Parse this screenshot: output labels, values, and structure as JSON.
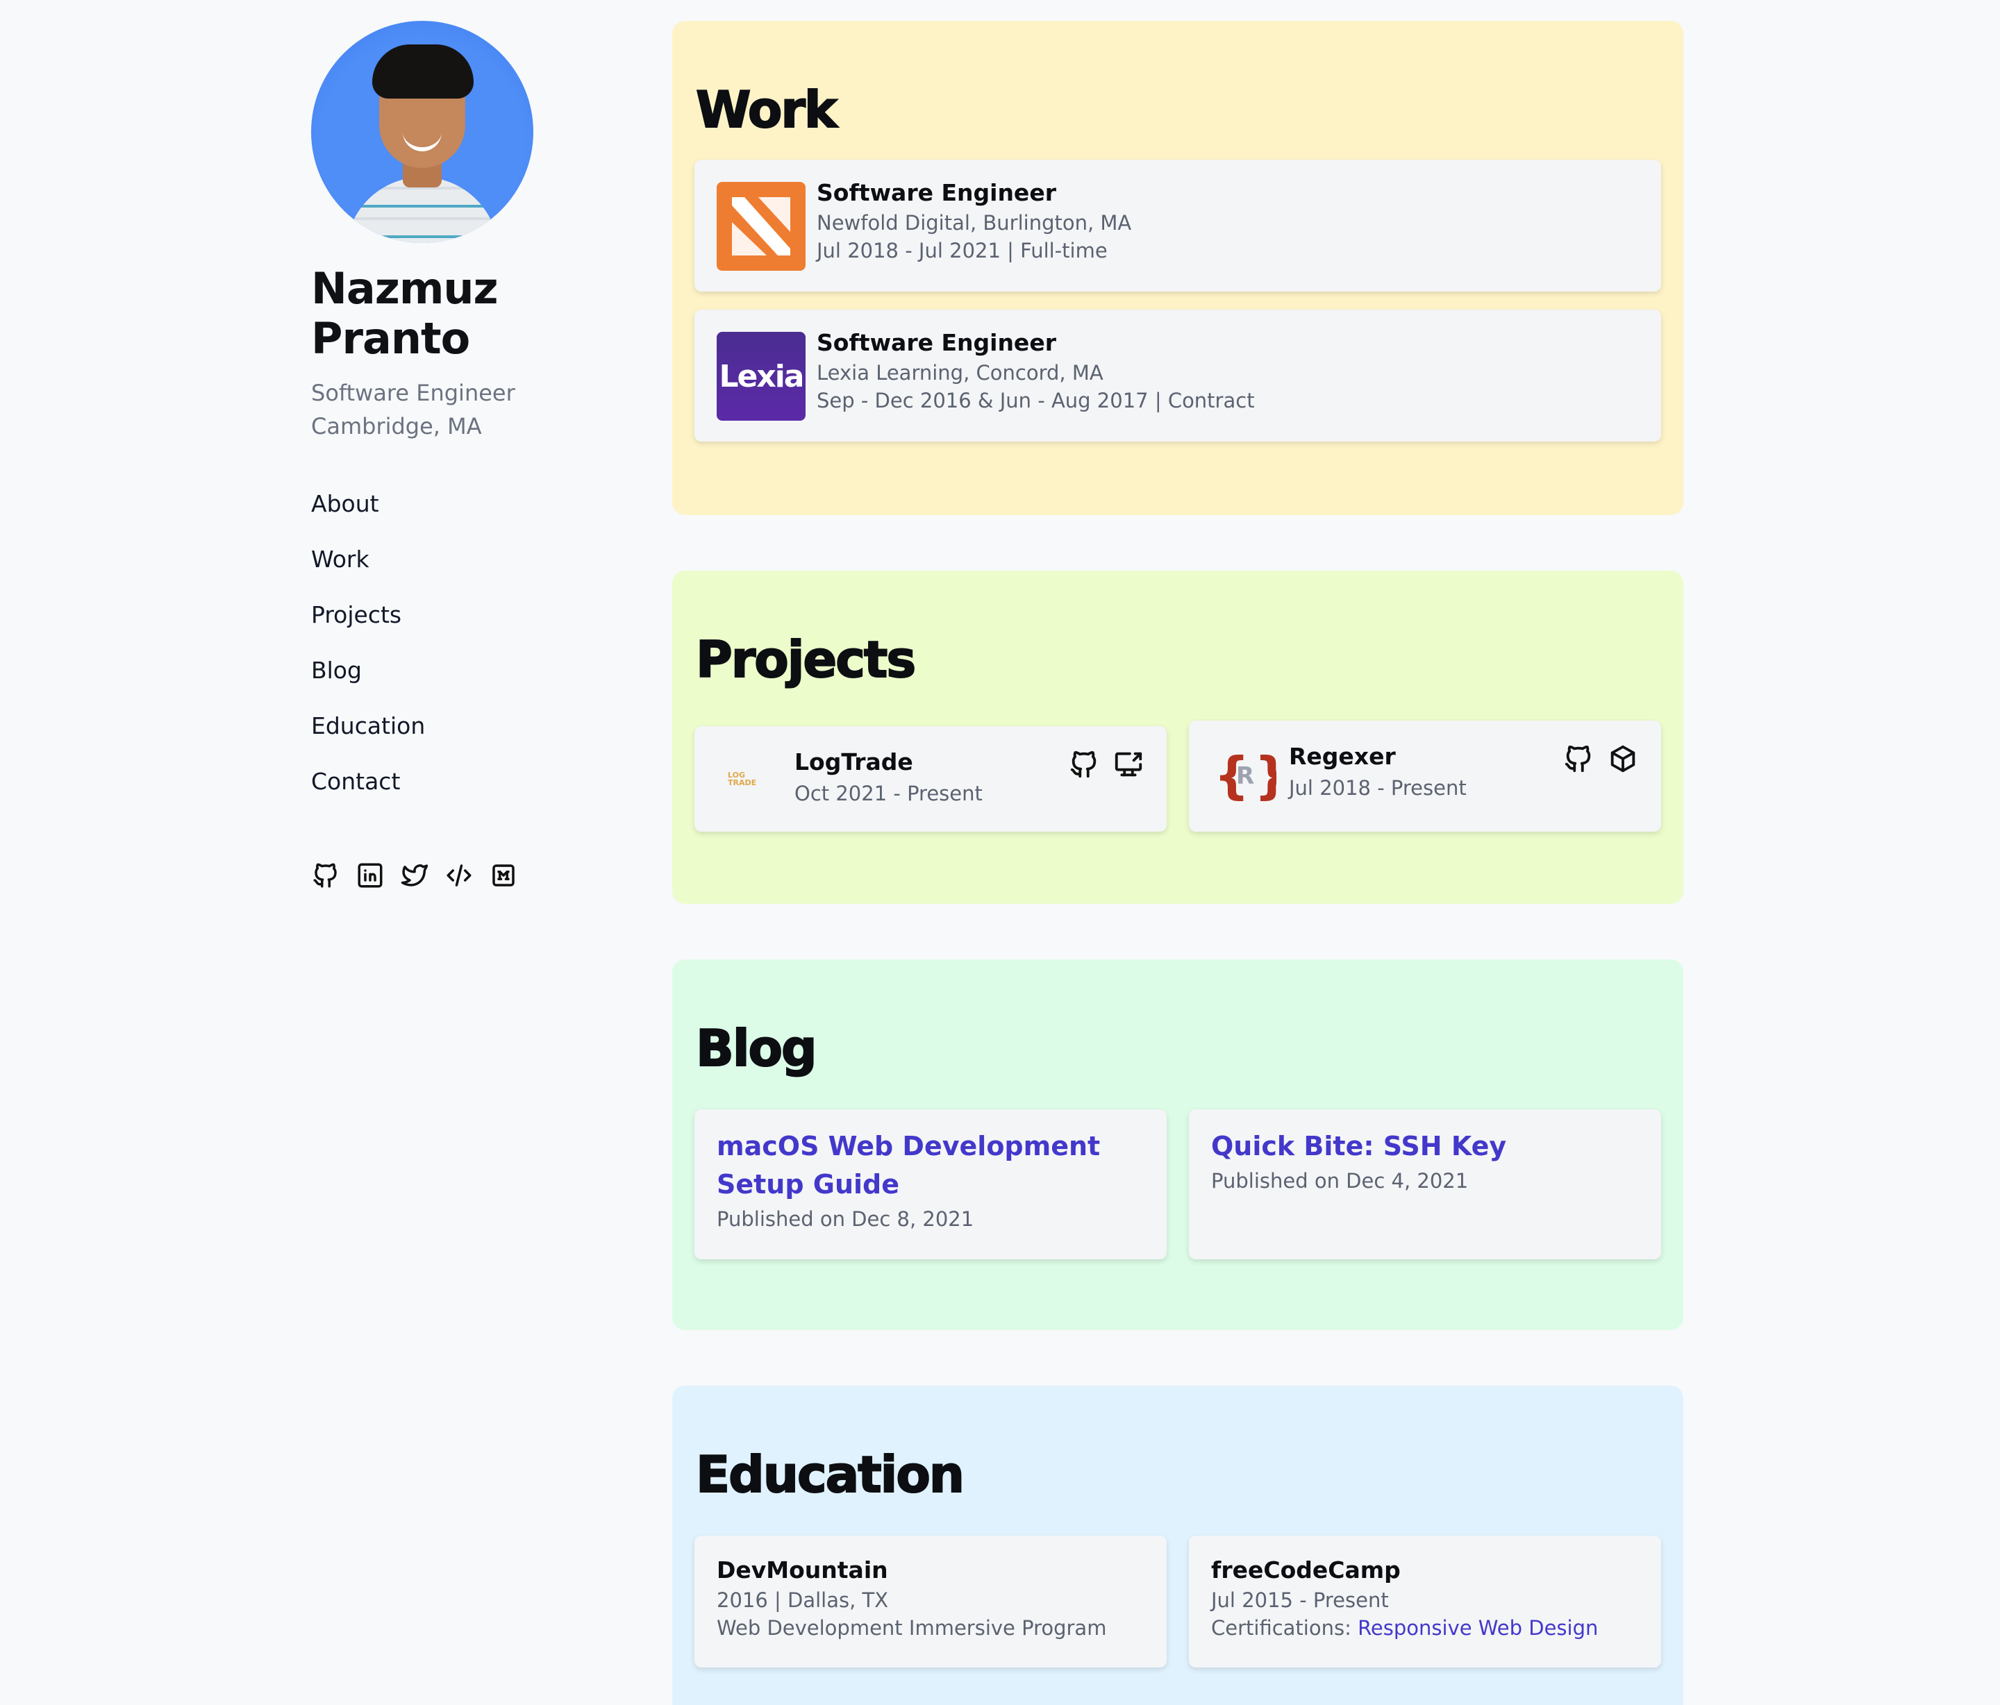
{
  "profile": {
    "name_line1": "Nazmuz",
    "name_line2": "Pranto",
    "role": "Software Engineer",
    "location": "Cambridge, MA"
  },
  "nav": [
    "About",
    "Work",
    "Projects",
    "Blog",
    "Education",
    "Contact"
  ],
  "socials": [
    "github-icon",
    "linkedin-icon",
    "twitter-icon",
    "code-icon",
    "medium-icon"
  ],
  "colors": {
    "work_bg": "#fef3c7",
    "projects_bg": "#ecfccb",
    "blog_bg": "#dcfce7",
    "education_bg": "#e0f2fe",
    "link": "#4338ca"
  },
  "work": {
    "heading": "Work",
    "items": [
      {
        "title": "Software Engineer",
        "company": "Newfold Digital, Burlington, MA",
        "dates": "Jul 2018 - Jul 2021 | Full-time",
        "logo": "newfold-logo"
      },
      {
        "title": "Software Engineer",
        "company": "Lexia Learning, Concord, MA",
        "dates": "Sep - Dec 2016 & Jun - Aug 2017 | Contract",
        "logo": "lexia-logo",
        "logo_text": "Lexia"
      }
    ]
  },
  "projects": {
    "heading": "Projects",
    "items": [
      {
        "title": "LogTrade",
        "dates": "Oct 2021 - Present",
        "logo_text": "LOG TRADE"
      },
      {
        "title": "Regexer",
        "dates": "Jul 2018 - Present",
        "logo_text": "R"
      }
    ]
  },
  "blog": {
    "heading": "Blog",
    "items": [
      {
        "title": "macOS Web Development Setup Guide",
        "published": "Published on Dec 8, 2021"
      },
      {
        "title": "Quick Bite: SSH Key",
        "published": "Published on Dec 4, 2021"
      }
    ]
  },
  "education": {
    "heading": "Education",
    "items": [
      {
        "title": "DevMountain",
        "line1": "2016 | Dallas, TX",
        "line2": "Web Development Immersive Program"
      },
      {
        "title": "freeCodeCamp",
        "line1": "Jul 2015 - Present",
        "line2_prefix": "Certifications: ",
        "line2_link": "Responsive Web Design"
      }
    ]
  }
}
